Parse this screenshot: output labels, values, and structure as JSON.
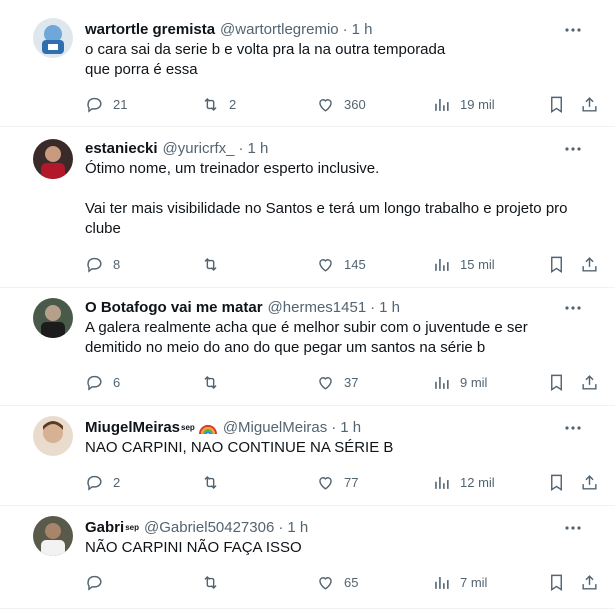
{
  "tweets": [
    {
      "name": "wartortle gremista",
      "handle": "@wartortlegremio",
      "time": "1 h",
      "lines": [
        "o cara sai da serie b e volta pra la na outra temporada",
        "que porra é essa"
      ],
      "replies": "21",
      "retweets": "2",
      "likes": "360",
      "views": "19 mil"
    },
    {
      "name": "estaniecki",
      "handle": "@yuricrfx_",
      "time": "1 h",
      "lines": [
        "Ótimo nome, um treinador esperto inclusive.",
        "",
        "Vai ter mais visibilidade no Santos e terá um longo trabalho e projeto pro",
        "clube"
      ],
      "replies": "8",
      "retweets": "",
      "likes": "145",
      "views": "15 mil"
    },
    {
      "name": "O Botafogo vai me matar",
      "handle": "@hermes1451",
      "time": "1 h",
      "lines": [
        "A galera realmente acha que é melhor subir com o juventude e ser",
        "demitido no meio do ano do que pegar um santos na série b"
      ],
      "replies": "6",
      "retweets": "",
      "likes": "37",
      "views": "9 mil"
    },
    {
      "name": "MiugelMeiras",
      "name_sup": "sep",
      "handle": "@MiguelMeiras",
      "time": "1 h",
      "lines": [
        "NAO CARPINI, NAO CONTINUE NA SÉRIE B"
      ],
      "replies": "2",
      "retweets": "",
      "likes": "77",
      "views": "12 mil"
    },
    {
      "name": "Gabri",
      "name_sup": "sep",
      "handle": "@Gabriel50427306",
      "time": "1 h",
      "lines": [
        "NÃO CARPINI NÃO FAÇA ISSO"
      ],
      "replies": "",
      "retweets": "",
      "likes": "65",
      "views": "7 mil"
    }
  ],
  "icons": {
    "more": "more-icon",
    "reply": "reply-icon",
    "retweet": "retweet-icon",
    "like": "like-icon",
    "views": "views-icon",
    "bookmark": "bookmark-icon",
    "share": "share-icon"
  },
  "colors": {
    "text": "#0f1419",
    "secondary": "#536471",
    "divider": "#eff3f4"
  }
}
